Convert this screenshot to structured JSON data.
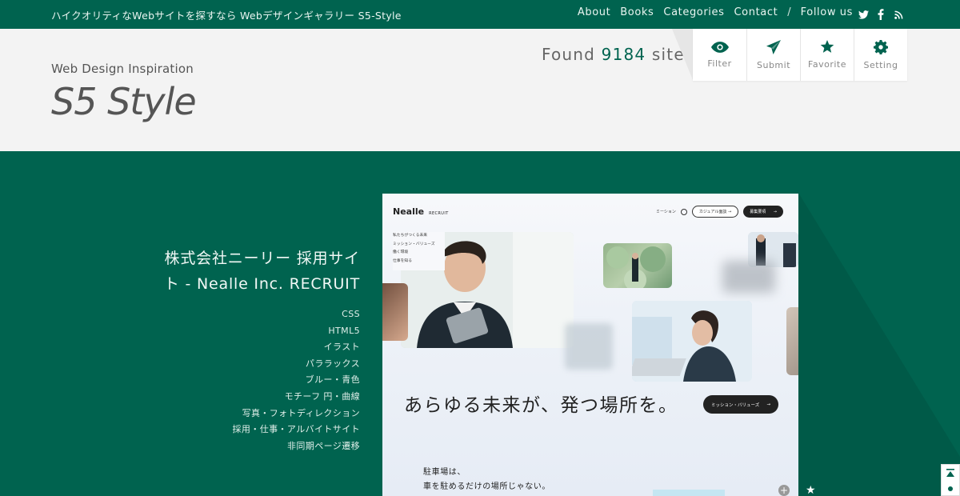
{
  "topbar": {
    "tagline": "ハイクオリティなWebサイトを探すなら Webデザインギャラリー S5-Style",
    "nav": [
      "About",
      "Books",
      "Categories",
      "Contact"
    ],
    "separator": "/",
    "follow_label": "Follow us",
    "social_icons": [
      "twitter-icon",
      "facebook-icon",
      "rss-icon"
    ]
  },
  "header": {
    "subtitle": "Web Design Inspiration",
    "logo": "S5 Style",
    "found_prefix": "Found",
    "found_count": "9184",
    "found_suffix": "site",
    "tools": [
      {
        "label": "Filter",
        "icon": "eye-icon"
      },
      {
        "label": "Submit",
        "icon": "paper-plane-icon"
      },
      {
        "label": "Favorite",
        "icon": "star-icon"
      },
      {
        "label": "Setting",
        "icon": "gear-icon"
      }
    ]
  },
  "site": {
    "title_line1": "株式会社ニーリー 採用サイ",
    "title_line2": "ト - Nealle Inc. RECRUIT",
    "tags": [
      "CSS",
      "HTML5",
      "イラスト",
      "パララックス",
      "ブルー・青色",
      "モチーフ 円・曲線",
      "写真・フォトディレクション",
      "採用・仕事・アルバイトサイト",
      "非同期ページ遷移"
    ]
  },
  "screenshot": {
    "brand": "Nealle",
    "brand_sub": "RECRUIT",
    "nav_text": "ミーション",
    "nav_btn1": "カジュアル面談",
    "nav_btn2": "募集要項",
    "menu": [
      "私たちがつくる未来",
      "ミッション・バリューズ",
      "働く環境",
      "仕事を知る"
    ],
    "headline": "あらゆる未来が、発つ場所を。",
    "cta": "ミッション・バリューズ",
    "copy_line1": "駐車場は、",
    "copy_line2": "車を駐めるだけの場所じゃない。"
  },
  "colors": {
    "brand_green": "#00634f",
    "header_bg": "#f3f3f3"
  }
}
